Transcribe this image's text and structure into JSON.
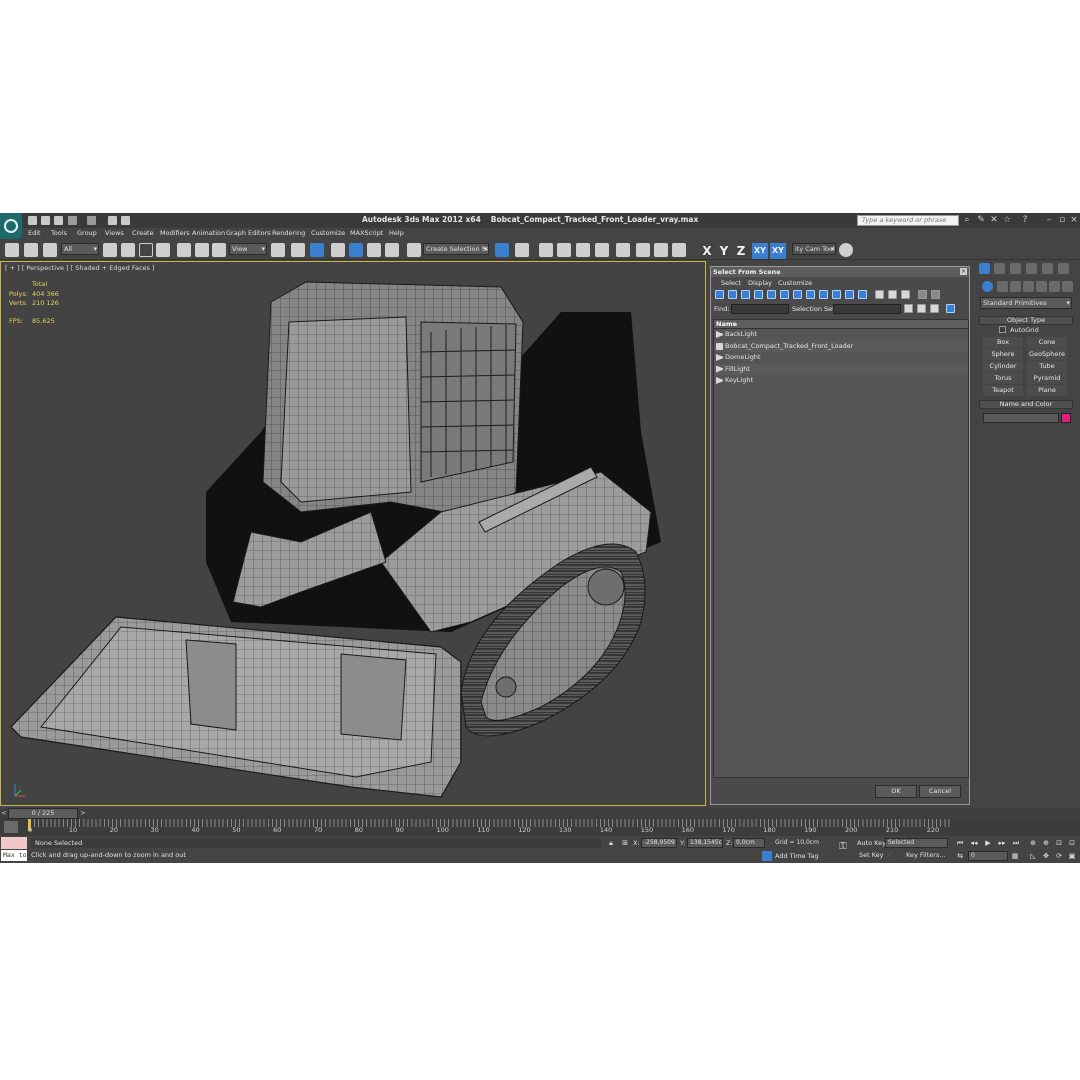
{
  "app": {
    "title": "Autodesk 3ds Max  2012 x64",
    "file": "Bobcat_Compact_Tracked_Front_Loader_vray.max",
    "search_placeholder": "Type a keyword or phrase"
  },
  "menu": [
    "Edit",
    "Tools",
    "Group",
    "Views",
    "Create",
    "Modifiers",
    "Animation",
    "Graph Editors",
    "Rendering",
    "Customize",
    "MAXScript",
    "Help"
  ],
  "toolbar": {
    "filter_value": "All",
    "refcoord_value": "View",
    "named_selection_value": "Create Selection Se",
    "axis_x": "X",
    "axis_y": "Y",
    "axis_z": "Z",
    "axis_xy": "XY",
    "axis_xy2": "XY",
    "cam_tool_label": "ity Cam Tool"
  },
  "viewport": {
    "label": "[ + ] [ Perspective ] [ Shaded + Edged Faces ]",
    "stats": {
      "total_label": "Total",
      "polys_label": "Polys:",
      "polys_value": "404 366",
      "verts_label": "Verts:",
      "verts_value": "210 126",
      "fps_label": "FPS:",
      "fps_value": "85,625"
    }
  },
  "select_from_scene": {
    "title": "Select From Scene",
    "menu": [
      "Select",
      "Display",
      "Customize"
    ],
    "find_label": "Find:",
    "selection_set_label": "Selection Set:",
    "column_name": "Name",
    "items": [
      "BackLight",
      "Bobcat_Compact_Tracked_Front_Loader",
      "DomeLight",
      "FillLight",
      "KeyLight"
    ],
    "ok_label": "OK",
    "cancel_label": "Cancel"
  },
  "command_panel": {
    "category": "Standard Primitives",
    "object_type_label": "Object Type",
    "autogrid_label": "AutoGrid",
    "primitives": [
      "Box",
      "Cone",
      "Sphere",
      "GeoSphere",
      "Cylinder",
      "Tube",
      "Torus",
      "Pyramid",
      "Teapot",
      "Plane"
    ],
    "name_color_label": "Name and Color",
    "object_color": "#e0207a"
  },
  "timeline": {
    "frame_display": "0 / 225",
    "ticks": [
      "0",
      "10",
      "20",
      "30",
      "40",
      "50",
      "60",
      "70",
      "80",
      "90",
      "100",
      "110",
      "120",
      "130",
      "140",
      "150",
      "160",
      "170",
      "180",
      "190",
      "200",
      "210",
      "220"
    ]
  },
  "status": {
    "maxscript_label": "Max to",
    "selection": "None Selected",
    "prompt": "Click and drag up-and-down to zoom in and out",
    "x_label": "X:",
    "x_value": "-258,9509",
    "y_label": "Y:",
    "y_value": "138,1545c",
    "z_label": "Z:",
    "z_value": "0,0cm",
    "grid": "Grid = 10,0cm",
    "add_time_tag": "Add Time Tag",
    "auto_key": "Auto Key",
    "auto_key_mode": "Selected",
    "set_key": "Set Key",
    "key_filters": "Key Filters...",
    "current_frame": "0"
  }
}
